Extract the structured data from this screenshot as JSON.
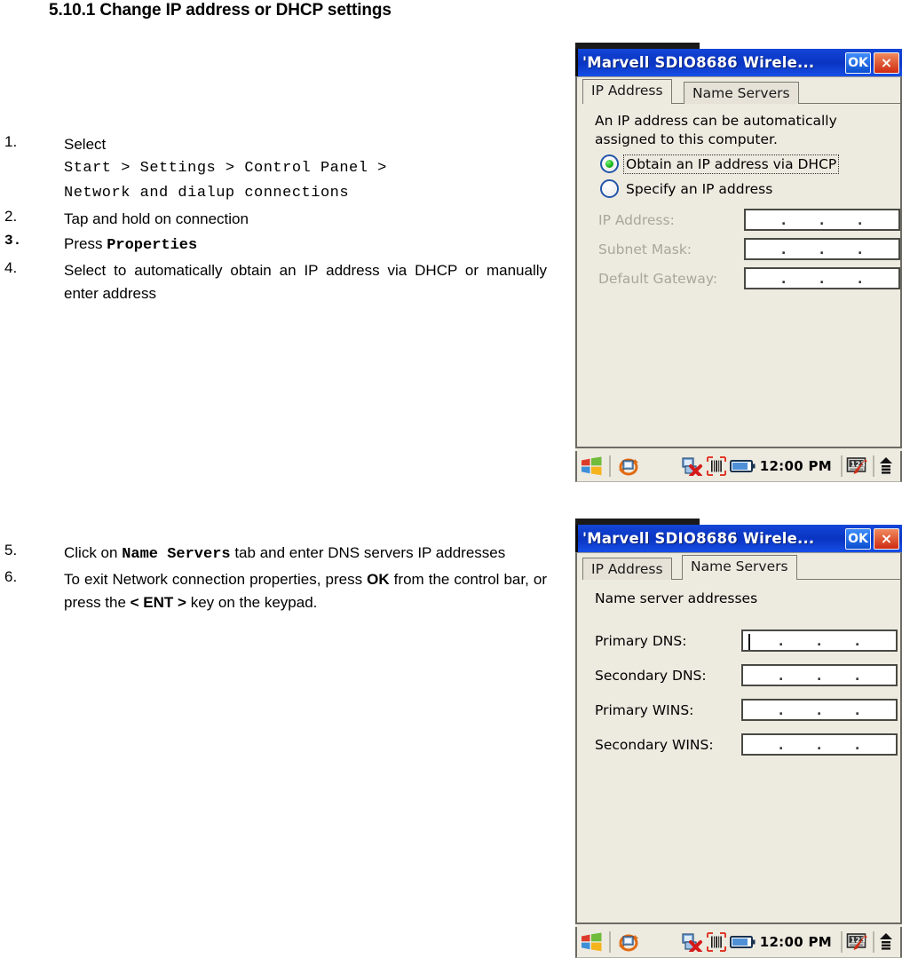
{
  "document": {
    "heading": "5.10.1 Change IP address or DHCP settings"
  },
  "steps_top": [
    {
      "num": "1.",
      "lines": [
        {
          "text": "Select",
          "style": "normal"
        },
        {
          "text": "Start > Settings > Control Panel >",
          "style": "mono"
        },
        {
          "text": "Network and dialup connections",
          "style": "mono"
        }
      ]
    },
    {
      "num": "2.",
      "lines": [
        {
          "text": "Tap and hold on connection",
          "style": "normal"
        }
      ]
    },
    {
      "num": "3.",
      "num_style": "mono-bold",
      "lines": [
        {
          "text": "Press ",
          "style": "normal",
          "bold_tail": "Properties"
        }
      ]
    },
    {
      "num": "4.",
      "lines": [
        {
          "text": "Select to automatically obtain an IP address via DHCP or manually enter address",
          "style": "normal"
        }
      ]
    }
  ],
  "steps_bottom": [
    {
      "num": "5.",
      "prefix": "Click on ",
      "bold": "Name Servers",
      "suffix": " tab and enter DNS servers IP addresses"
    },
    {
      "num": "6.",
      "prefix": "To exit Network connection properties, press ",
      "bold": "OK",
      "middle": " from the control bar, or press the ",
      "bold2": "< ENT >",
      "suffix": " key on the keypad."
    }
  ],
  "device_top": {
    "title": "'Marvell SDIO8686 Wirele...",
    "ok_label": "OK",
    "close_label": "×",
    "tabs": [
      {
        "label": "IP Address",
        "active": true
      },
      {
        "label": "Name Servers",
        "active": false
      }
    ],
    "description": "An IP address can be automatically assigned to this computer.",
    "radios": [
      {
        "label": "Obtain an IP address via DHCP",
        "selected": true,
        "focused": true
      },
      {
        "label": "Specify an IP address",
        "selected": false,
        "focused": false
      }
    ],
    "fields": [
      {
        "label": "IP Address:",
        "value": "",
        "disabled": true
      },
      {
        "label": "Subnet Mask:",
        "value": "",
        "disabled": true
      },
      {
        "label": "Default Gateway:",
        "value": "",
        "disabled": true
      }
    ],
    "taskbar": {
      "start_icon": "windows-start-icon",
      "network_icon": "network-connection-icon",
      "disconnect_icon": "network-disconnected-icon",
      "barcode_icon": "barcode-scanner-icon",
      "battery_icon": "battery-icon",
      "clock": "12:00 PM",
      "sip_icon": "input-panel-icon",
      "arrow_icon": "up-arrow-icon"
    }
  },
  "device_bottom": {
    "title": "'Marvell SDIO8686 Wirele...",
    "ok_label": "OK",
    "close_label": "×",
    "tabs": [
      {
        "label": "IP Address",
        "active": false
      },
      {
        "label": "Name Servers",
        "active": true
      }
    ],
    "panel_title": "Name server addresses",
    "fields": [
      {
        "label": "Primary DNS:",
        "value": "",
        "caret": true
      },
      {
        "label": "Secondary DNS:",
        "value": "",
        "caret": false
      },
      {
        "label": "Primary WINS:",
        "value": "",
        "caret": false
      },
      {
        "label": "Secondary WINS:",
        "value": "",
        "caret": false
      }
    ],
    "taskbar": {
      "clock": "12:00 PM"
    }
  },
  "colors": {
    "titlebar_blue": "#0b36c4",
    "dialog_bg": "#EDEAE0",
    "radio_green": "#16b416",
    "close_red": "#cf2b12",
    "ok_blue": "#0a4fd0"
  }
}
